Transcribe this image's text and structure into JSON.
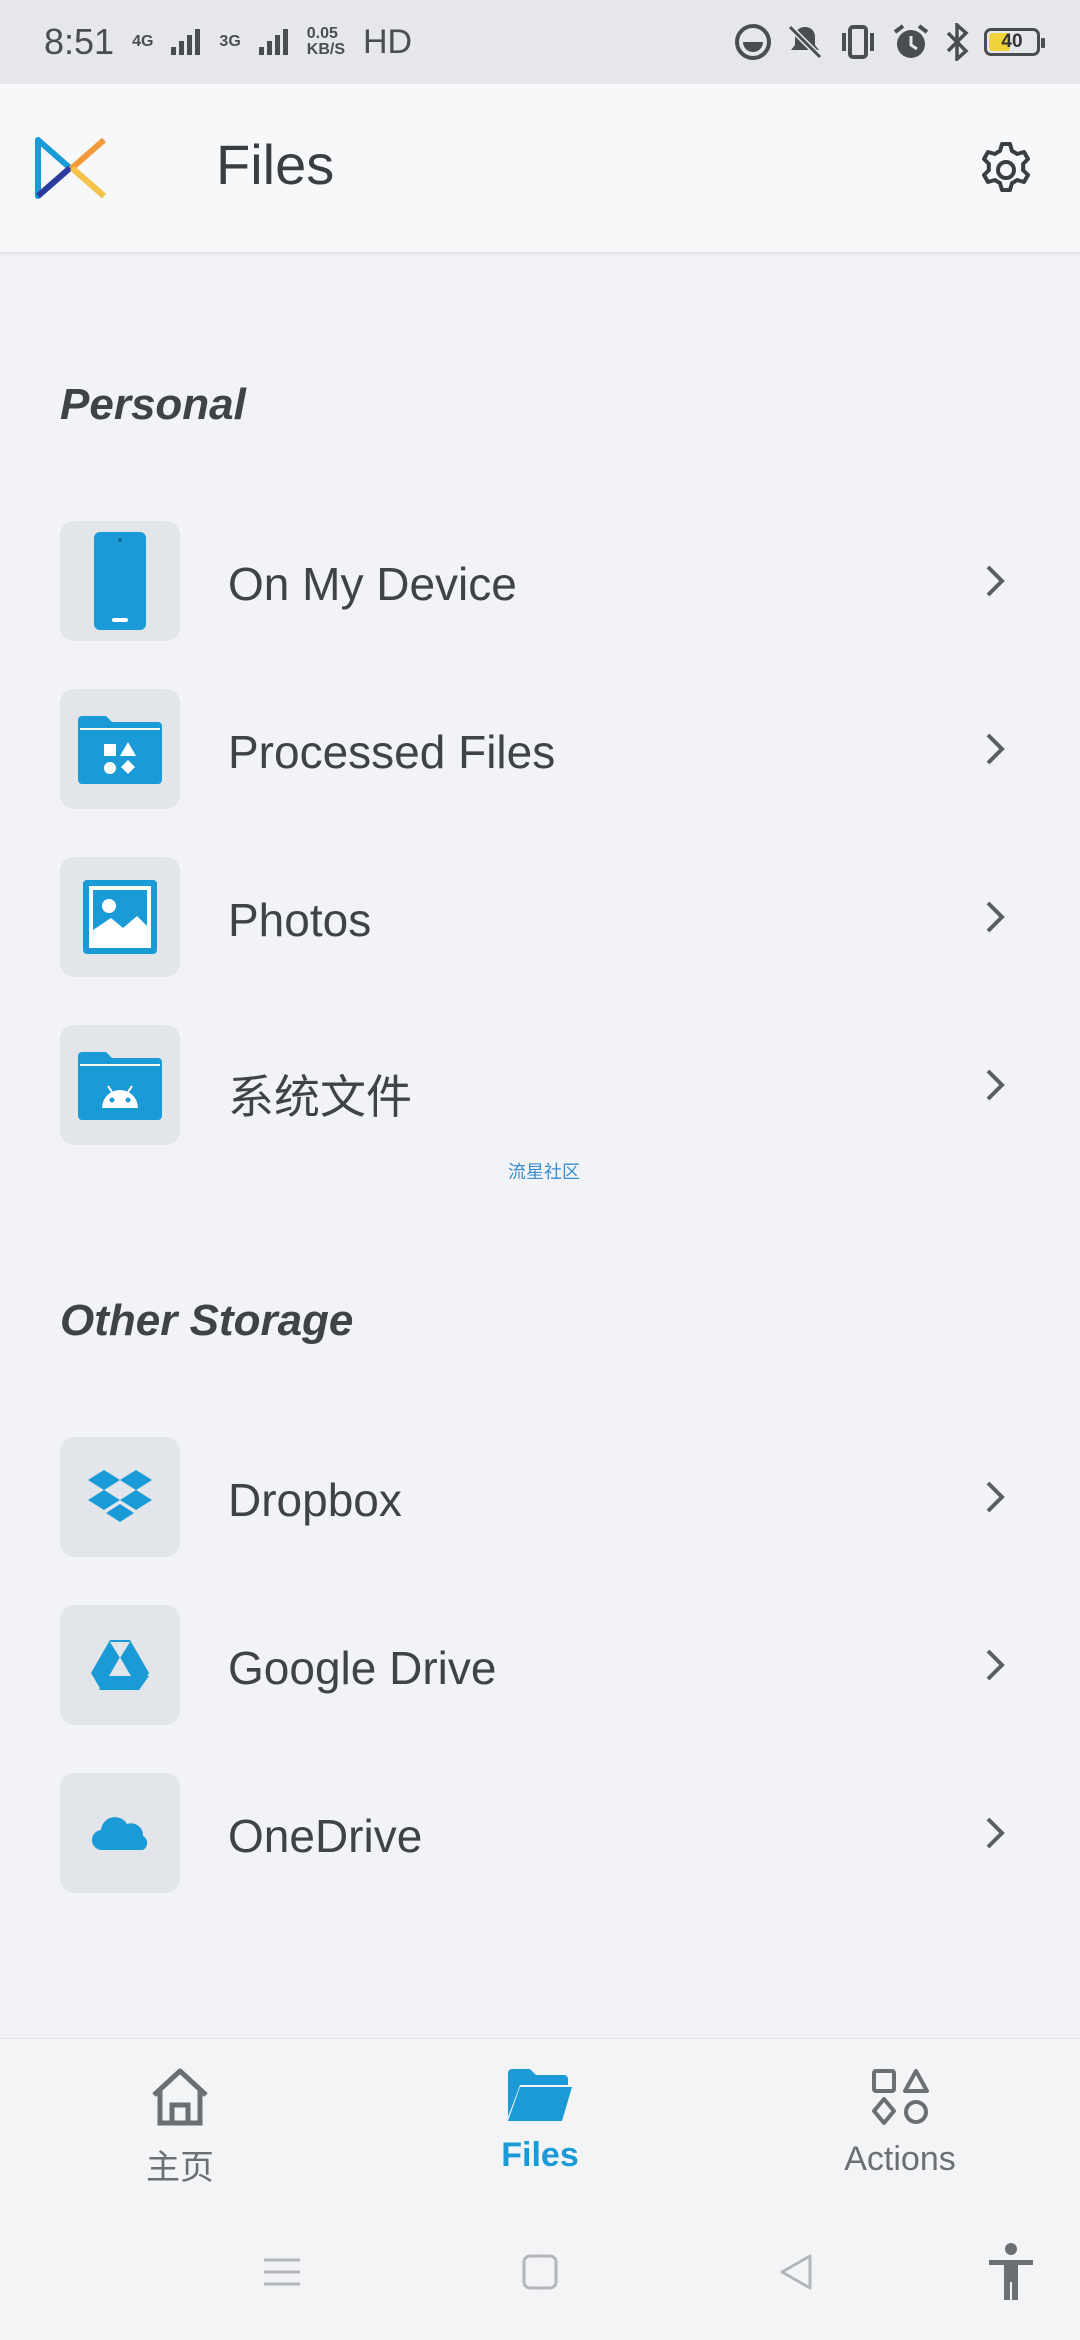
{
  "status_bar": {
    "time": "8:51",
    "network1": "4G",
    "network2": "3G",
    "speed_value": "0.05",
    "speed_unit": "KB/S",
    "hd": "HD",
    "battery": "40"
  },
  "header": {
    "title": "Files"
  },
  "sections": {
    "personal": {
      "title": "Personal",
      "items": [
        {
          "label": "On My Device"
        },
        {
          "label": "Processed Files"
        },
        {
          "label": "Photos"
        },
        {
          "label": "系统文件"
        }
      ]
    },
    "other": {
      "title": "Other Storage",
      "items": [
        {
          "label": "Dropbox"
        },
        {
          "label": "Google Drive"
        },
        {
          "label": "OneDrive"
        }
      ]
    }
  },
  "watermark": "流星社区",
  "bottom_nav": {
    "home": "主页",
    "files": "Files",
    "actions": "Actions"
  },
  "colors": {
    "accent": "#1a9ad6",
    "text": "#3f4348",
    "tile": "#e2e5e9"
  }
}
